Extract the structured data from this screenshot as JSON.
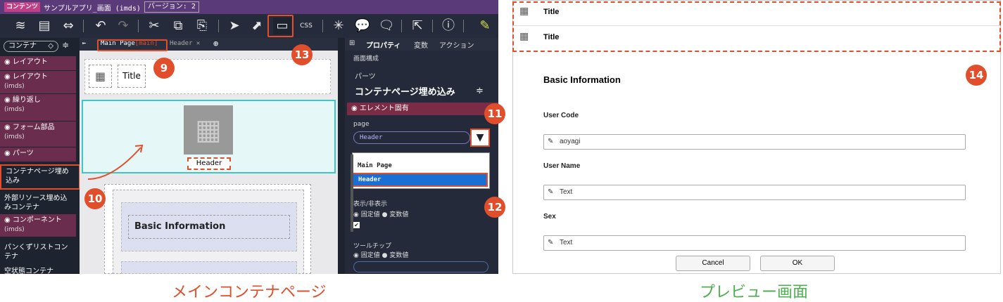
{
  "editor": {
    "badge": "コンテンツ",
    "app_title": "サンプルアプリ_画面 (imds)",
    "version": "バージョン: 2",
    "sidebar_select": "コンテナ",
    "sidebar": [
      {
        "label": "レイアウト",
        "sub": ""
      },
      {
        "label": "レイアウト",
        "sub": "(imds)"
      },
      {
        "label": "繰り返し",
        "sub": "(imds)"
      },
      {
        "label": "フォーム部品",
        "sub": "(imds)"
      },
      {
        "label": "パーツ",
        "sub": ""
      },
      {
        "label": "コンテナページ埋め込み",
        "sub": ""
      },
      {
        "label": "外部リソース埋め込みコンテナ",
        "sub": ""
      },
      {
        "label": "コンポーネント",
        "sub": "(imds)"
      },
      {
        "label": "パンくずリストコンテナ",
        "sub": ""
      },
      {
        "label": "空状態コンテナ",
        "sub": ""
      }
    ],
    "tabs": {
      "main": "Main Page",
      "main_tag": "[main]",
      "header": "Header"
    },
    "canvas": {
      "title_label": "Title",
      "header_label": "Header",
      "basic_info": "Basic Information"
    },
    "props": {
      "tabs": [
        "プロパティ",
        "変数",
        "アクション"
      ],
      "section": "画面構成",
      "parts": "パーツ",
      "component": "コンテナページ埋め込み",
      "group": "エレメント固有",
      "page_label": "page",
      "page_value": "Header",
      "options": [
        "Main Page",
        "Header"
      ],
      "visibility": "表示/非表示",
      "fixed": "固定値",
      "variable": "変数値",
      "tooltip": "ツールチップ"
    }
  },
  "callouts": [
    "9",
    "10",
    "11",
    "12",
    "13",
    "14"
  ],
  "preview": {
    "titles": [
      "Title",
      "Title"
    ],
    "heading": "Basic Information",
    "fields": [
      {
        "label": "User Code",
        "value": "aoyagi"
      },
      {
        "label": "User Name",
        "value": "Text"
      },
      {
        "label": "Sex",
        "value": "Text"
      }
    ],
    "cancel": "Cancel",
    "ok": "OK"
  },
  "captions": {
    "left": "メインコンテナページ",
    "right": "プレビュー画面"
  },
  "colors": {
    "accent": "#e04e2b",
    "selected": "#1a6fd4",
    "left_caption": "#e04e2b",
    "right_caption": "#4caf50"
  }
}
